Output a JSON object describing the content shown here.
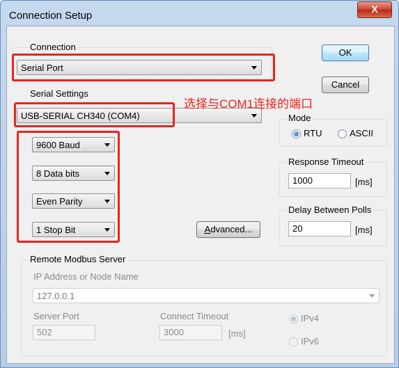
{
  "window": {
    "title": "Connection Setup",
    "close_label": "X"
  },
  "connection": {
    "label": "Connection",
    "value": "Serial Port"
  },
  "buttons": {
    "ok": "OK",
    "cancel": "Cancel",
    "advanced_prefix": "A",
    "advanced_rest": "dvanced..."
  },
  "serial": {
    "label": "Serial Settings",
    "port": "USB-SERIAL CH340 (COM4)",
    "baud": "9600 Baud",
    "data_bits": "8 Data bits",
    "parity": "Even Parity",
    "stop_bits": "1 Stop Bit"
  },
  "annotation": {
    "text": "选择与COM1连接的端口",
    "color": "#e8241e"
  },
  "mode": {
    "label": "Mode",
    "rtu": "RTU",
    "ascii": "ASCII",
    "selected": "RTU"
  },
  "response_timeout": {
    "label": "Response Timeout",
    "value": "1000",
    "unit": "[ms]"
  },
  "delay_polls": {
    "label": "Delay Between Polls",
    "value": "20",
    "unit": "[ms]"
  },
  "remote": {
    "label": "Remote Modbus Server",
    "ip_label": "IP Address or Node Name",
    "ip_value": "127.0.0.1",
    "port_label": "Server Port",
    "port_value": "502",
    "timeout_label": "Connect Timeout",
    "timeout_value": "3000",
    "timeout_unit": "[ms]",
    "ipv4": "IPv4",
    "ipv6": "IPv6"
  }
}
